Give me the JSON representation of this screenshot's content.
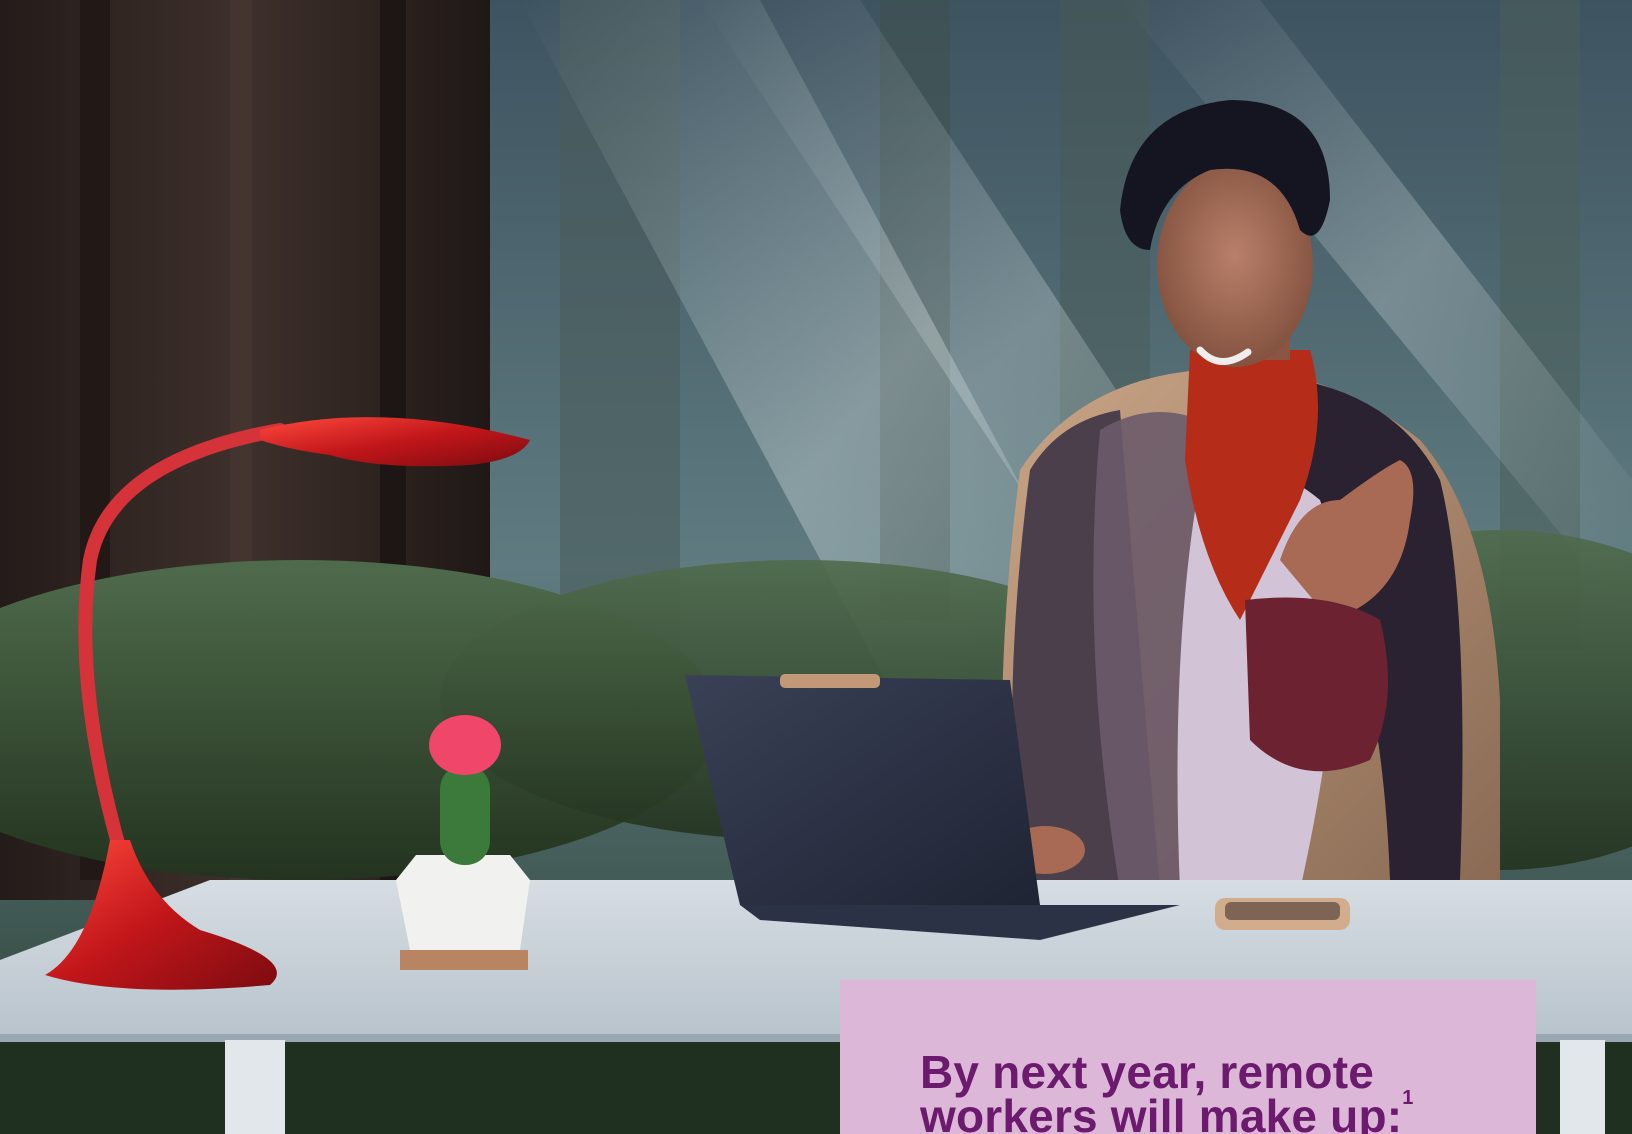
{
  "callout": {
    "line1": "By next year, remote",
    "line2": "workers will make up:",
    "footnote_mark": "1",
    "background": "#dcb7d8",
    "text_color": "#6b1a6e"
  },
  "scene": {
    "subject": "person-at-laptop",
    "props": [
      "desk-lamp-icon",
      "cactus-icon",
      "laptop-icon",
      "phone-icon"
    ]
  }
}
